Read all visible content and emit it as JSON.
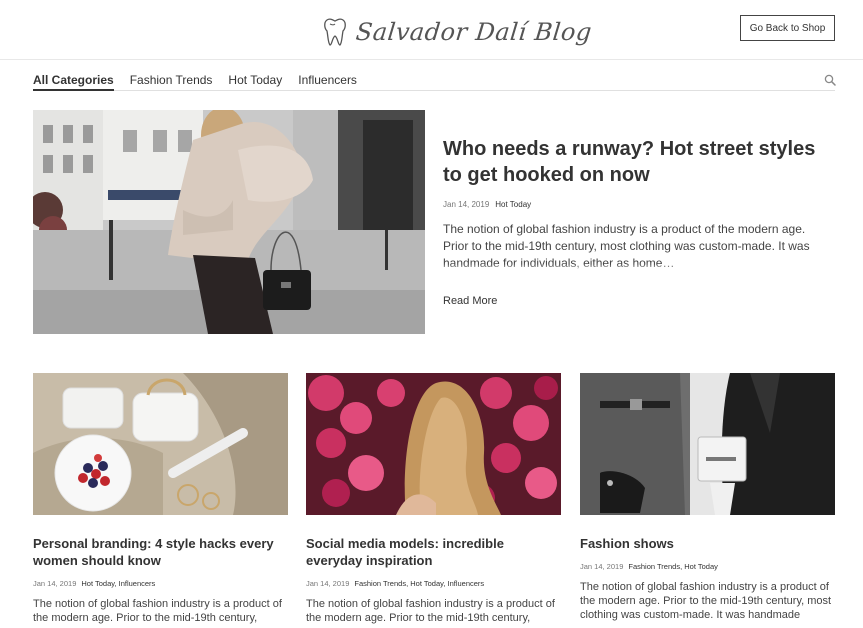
{
  "header": {
    "logo_text": "Salvador Dalí Blog",
    "shop_button_label": "Go Back to Shop"
  },
  "nav": {
    "items": [
      "All Categories",
      "Fashion Trends",
      "Hot Today",
      "Influencers"
    ],
    "active": "All Categories"
  },
  "featured": {
    "title": "Who needs a runway? Hot street styles to get hooked on now",
    "date": "Jan 14, 2019",
    "categories": "Hot Today",
    "excerpt": "The notion of global fashion industry is a product of the modern age. Prior to the mid-19th century, most clothing was custom-made. It was handmade for individuals, either as home…",
    "read_more_label": "Read More"
  },
  "posts": [
    {
      "title": "Personal branding: 4 style hacks every women should know",
      "date": "Jan 14, 2019",
      "categories": "Hot Today, Influencers",
      "excerpt": "The notion of global fashion industry is a product of the modern age. Prior to the mid-19th century,"
    },
    {
      "title": "Social media models: incredible everyday inspiration",
      "date": "Jan 14, 2019",
      "categories": "Fashion Trends, Hot Today, Influencers",
      "excerpt": "The notion of global fashion industry is a product of the modern age. Prior to the mid-19th century,"
    },
    {
      "title": "Fashion shows",
      "date": "Jan 14, 2019",
      "categories": "Fashion Trends, Hot Today",
      "excerpt": "The notion of global fashion industry is a product of the modern age. Prior to the mid-19th century, most clothing was custom-made. It was handmade"
    }
  ],
  "icons": {
    "logo": "tooth-icon",
    "search": "search-icon"
  }
}
